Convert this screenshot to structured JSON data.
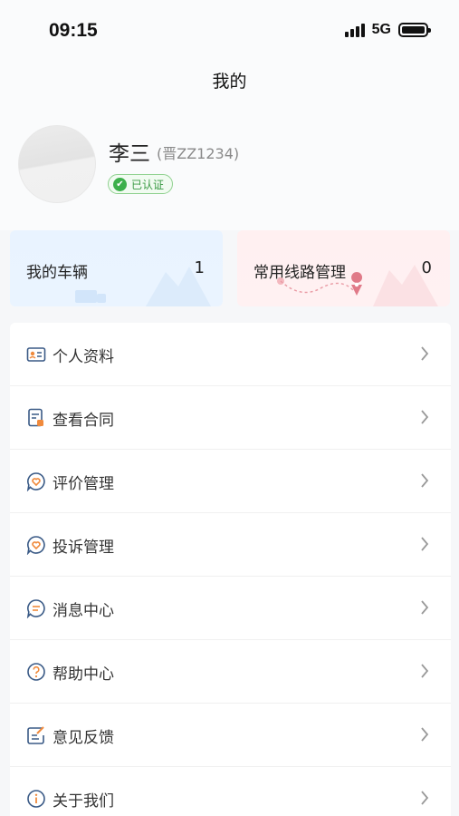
{
  "status": {
    "time": "09:15",
    "network": "5G"
  },
  "page": {
    "title": "我的"
  },
  "profile": {
    "name": "李三",
    "plate": "(晋ZZ1234)",
    "verified_label": "已认证"
  },
  "stats": [
    {
      "label": "我的车辆",
      "value": "1",
      "color": "#eaf4ff"
    },
    {
      "label": "常用线路管理",
      "value": "0",
      "color": "#fff1f2"
    }
  ],
  "menu": [
    {
      "label": "个人资料",
      "icon": "id-card-icon"
    },
    {
      "label": "查看合同",
      "icon": "contract-icon"
    },
    {
      "label": "评价管理",
      "icon": "heart-chat-icon"
    },
    {
      "label": "投诉管理",
      "icon": "heart-chat-icon"
    },
    {
      "label": "消息中心",
      "icon": "message-icon"
    },
    {
      "label": "帮助中心",
      "icon": "help-icon"
    },
    {
      "label": "意见反馈",
      "icon": "feedback-icon"
    },
    {
      "label": "关于我们",
      "icon": "info-icon"
    }
  ],
  "colors": {
    "icon_blue": "#3a5a86",
    "icon_orange": "#f08a3c",
    "verified_green": "#3cb04a"
  }
}
